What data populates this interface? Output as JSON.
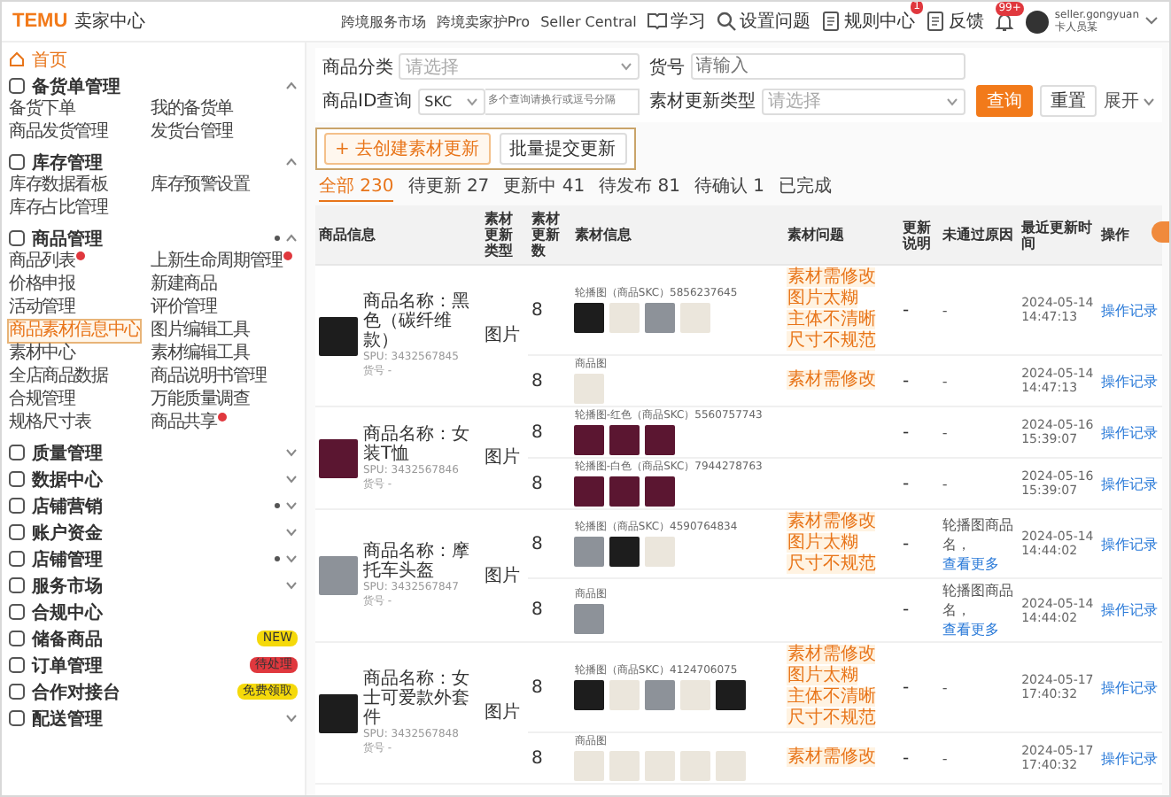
{
  "header": {
    "logo": "TEMU",
    "title": "卖家中心",
    "nav_links": [
      "跨境服务市场",
      "跨境卖家护Pro",
      "Seller Central"
    ],
    "tools": [
      {
        "label": "学习",
        "kind": "book"
      },
      {
        "label": "设置问题",
        "kind": "search"
      },
      {
        "label": "规则中心",
        "kind": "doc",
        "badge": "1"
      },
      {
        "label": "反馈",
        "kind": "doc"
      }
    ],
    "notifications": {
      "badge": "99+"
    },
    "user": {
      "name": "seller.gongyuan",
      "role": "卡人员某"
    }
  },
  "sidebar": {
    "home": "首页",
    "sections": [
      {
        "label": "备货单管理",
        "kind": "group",
        "expanded": true,
        "dot": false,
        "items": [
          {
            "label": "备货下单",
            "selected": false,
            "alert": false
          },
          {
            "label": "我的备货单",
            "selected": false,
            "alert": false
          },
          {
            "label": "商品发货管理",
            "selected": false,
            "alert": false
          },
          {
            "label": "发货台管理",
            "selected": false,
            "alert": false
          }
        ]
      },
      {
        "label": "库存管理",
        "kind": "group",
        "expanded": true,
        "dot": false,
        "items": [
          {
            "label": "库存数据看板",
            "selected": false,
            "alert": false
          },
          {
            "label": "库存预警设置",
            "selected": false,
            "alert": false
          },
          {
            "label": "库存占比管理",
            "selected": false,
            "alert": false
          }
        ]
      },
      {
        "label": "商品管理",
        "kind": "group",
        "expanded": true,
        "dot": true,
        "items": [
          {
            "label": "商品列表",
            "selected": false,
            "alert": true
          },
          {
            "label": "上新生命周期管理",
            "selected": false,
            "alert": true
          },
          {
            "label": "价格申报",
            "selected": false,
            "alert": false
          },
          {
            "label": "新建商品",
            "selected": false,
            "alert": false
          },
          {
            "label": "活动管理",
            "selected": false,
            "alert": false
          },
          {
            "label": "评价管理",
            "selected": false,
            "alert": false
          },
          {
            "label": "商品素材信息中心",
            "selected": true,
            "alert": false
          },
          {
            "label": "图片编辑工具",
            "selected": false,
            "alert": false
          },
          {
            "label": "素材中心",
            "selected": false,
            "alert": false
          },
          {
            "label": "素材编辑工具",
            "selected": false,
            "alert": false
          },
          {
            "label": "全店商品数据",
            "selected": false,
            "alert": false
          },
          {
            "label": "商品说明书管理",
            "selected": false,
            "alert": false
          },
          {
            "label": "合规管理",
            "selected": false,
            "alert": false
          },
          {
            "label": "万能质量调查",
            "selected": false,
            "alert": false
          },
          {
            "label": "规格尺寸表",
            "selected": false,
            "alert": false
          },
          {
            "label": "商品共享",
            "selected": false,
            "alert": true
          }
        ]
      },
      {
        "label": "质量管理",
        "kind": "group",
        "expanded": false,
        "dot": false
      },
      {
        "label": "数据中心",
        "kind": "group",
        "expanded": false,
        "dot": false
      },
      {
        "label": "店铺营销",
        "kind": "group",
        "expanded": false,
        "dot": true
      },
      {
        "label": "账户资金",
        "kind": "group",
        "expanded": false,
        "dot": false
      },
      {
        "label": "店铺管理",
        "kind": "group",
        "expanded": false,
        "dot": true
      },
      {
        "label": "服务市场",
        "kind": "group",
        "expanded": false,
        "dot": false
      },
      {
        "label": "合规中心",
        "kind": "link"
      },
      {
        "label": "储备商品",
        "kind": "link",
        "tag": {
          "text": "NEW",
          "color": "#f5d90a"
        }
      },
      {
        "label": "订单管理",
        "kind": "link",
        "tag": {
          "text": "待处理",
          "color": "#e0383e"
        }
      },
      {
        "label": "合作对接台",
        "kind": "link",
        "tag": {
          "text": "免费领取",
          "color": "#f5d90a"
        }
      },
      {
        "label": "配送管理",
        "kind": "group",
        "expanded": false,
        "dot": false
      }
    ]
  },
  "filters": [
    {
      "label": "商品分类",
      "kind": "select",
      "placeholder": "请选择"
    },
    {
      "label": "货号",
      "kind": "input",
      "placeholder": "请输入"
    },
    {
      "label": "商品ID查询",
      "kind": "combo",
      "value": "SKC",
      "placeholder": "多个查询请换行或逗号分隔"
    },
    {
      "label": "素材更新类型",
      "kind": "select",
      "placeholder": "请选择"
    }
  ],
  "filter_buttons": {
    "search": "查询",
    "reset": "重置",
    "expand": "展开"
  },
  "actions": [
    "+ 去创建素材更新",
    "批量提交更新"
  ],
  "tabs": [
    {
      "label": "全部 230",
      "selected": true
    },
    {
      "label": "待更新 27",
      "selected": false
    },
    {
      "label": "更新中 41",
      "selected": false
    },
    {
      "label": "待发布 81",
      "selected": false
    },
    {
      "label": "待确认 1",
      "selected": false
    },
    {
      "label": "已完成",
      "selected": false
    }
  ],
  "table": {
    "columns": [
      "商品信息",
      "素材更新类型",
      "素材更新数",
      "素材信息",
      "素材问题",
      "更新说明",
      "未通过原因",
      "最近更新时间",
      "操作"
    ],
    "groups": [
      {
        "product": {
          "name": "商品名称：黑色（碳纤维款）",
          "spu": "SPU: 3432567845",
          "extra": "货号 -",
          "photo": {
            "kind": "dark"
          }
        },
        "type": "图片",
        "subrows": [
          {
            "count": "8",
            "material": "轮播图（商品SKC）5856237645",
            "thumbs": [
              {
                "kind": "dark"
              },
              {
                "kind": "light"
              },
              {
                "kind": "grey"
              },
              {
                "kind": "light"
              }
            ],
            "issues": [
              "素材需修改",
              "图片太糊",
              "主体不清晰",
              "尺寸不规范"
            ],
            "note": "-",
            "reason": {
              "text": "-"
            },
            "time": "2024-05-14 14:47:13",
            "action": "操作记录"
          },
          {
            "count": "8",
            "material": "商品图",
            "thumbs": [
              {
                "kind": "light"
              }
            ],
            "issues": [
              "素材需修改"
            ],
            "note": "-",
            "reason": {
              "text": "-"
            },
            "time": "2024-05-14 14:47:13",
            "action": "操作记录"
          }
        ]
      },
      {
        "product": {
          "name": "商品名称：女装T恤",
          "spu": "SPU: 3432567846",
          "extra": "货号 -",
          "photo": {
            "kind": "maroon"
          }
        },
        "type": "图片",
        "subrows": [
          {
            "count": "8",
            "material": "轮播图-红色（商品SKC）5560757743",
            "thumbs": [
              {
                "kind": "maroon"
              },
              {
                "kind": "maroon"
              },
              {
                "kind": "maroon"
              }
            ],
            "issues": [],
            "note": "-",
            "reason": {
              "text": "-"
            },
            "time": "2024-05-16 15:39:07",
            "action": "操作记录"
          },
          {
            "count": "8",
            "material": "轮播图-白色（商品SKC）7944278763",
            "thumbs": [
              {
                "kind": "maroon"
              },
              {
                "kind": "maroon"
              },
              {
                "kind": "maroon"
              }
            ],
            "issues": [],
            "note": "-",
            "reason": {
              "text": "-"
            },
            "time": "2024-05-16 15:39:07",
            "action": "操作记录"
          }
        ]
      },
      {
        "product": {
          "name": "商品名称：摩托车头盔",
          "spu": "SPU: 3432567847",
          "extra": "货号 -",
          "photo": {
            "kind": "grey"
          }
        },
        "type": "图片",
        "subrows": [
          {
            "count": "8",
            "material": "轮播图（商品SKC）4590764834",
            "thumbs": [
              {
                "kind": "grey"
              },
              {
                "kind": "dark"
              },
              {
                "kind": "light"
              }
            ],
            "issues": [
              "素材需修改",
              "图片太糊",
              "尺寸不规范"
            ],
            "note": "-",
            "reason": {
              "text": "轮播图商品名，",
              "link": "查看更多"
            },
            "time": "2024-05-14 14:44:02",
            "action": "操作记录"
          },
          {
            "count": "8",
            "material": "商品图",
            "thumbs": [
              {
                "kind": "grey"
              }
            ],
            "issues": [],
            "note": "-",
            "reason": {
              "text": "轮播图商品名，",
              "link": "查看更多"
            },
            "time": "2024-05-14 14:44:02",
            "action": "操作记录"
          }
        ]
      },
      {
        "product": {
          "name": "商品名称：女士可爱款外套件",
          "spu": "SPU: 3432567848",
          "extra": "货号 -",
          "photo": {
            "kind": "dark"
          }
        },
        "type": "图片",
        "subrows": [
          {
            "count": "8",
            "material": "轮播图（商品SKC）4124706075",
            "thumbs": [
              {
                "kind": "dark"
              },
              {
                "kind": "light"
              },
              {
                "kind": "grey"
              },
              {
                "kind": "light"
              },
              {
                "kind": "dark"
              }
            ],
            "issues": [
              "素材需修改",
              "图片太糊",
              "主体不清晰",
              "尺寸不规范"
            ],
            "note": "-",
            "reason": {
              "text": "-"
            },
            "time": "2024-05-17 17:40:32",
            "action": "操作记录"
          },
          {
            "count": "8",
            "material": "商品图",
            "thumbs": [
              {
                "kind": "light"
              },
              {
                "kind": "light"
              },
              {
                "kind": "light"
              },
              {
                "kind": "light"
              },
              {
                "kind": "light"
              }
            ],
            "issues": [
              "素材需修改"
            ],
            "note": "-",
            "reason": {
              "text": "-"
            },
            "time": "2024-05-17 17:40:32",
            "action": "操作记录"
          }
        ]
      }
    ]
  }
}
